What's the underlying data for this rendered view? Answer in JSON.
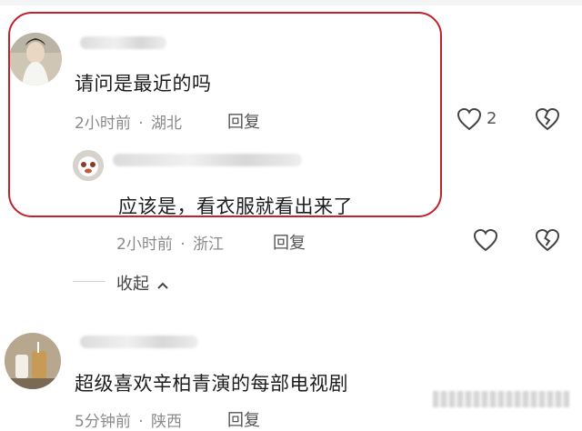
{
  "comments": [
    {
      "text": "请问是最近的吗",
      "time": "2小时前",
      "location": "湖北",
      "reply_label": "回复",
      "likes": "2",
      "like_icon": "heart-outline-icon",
      "dislike_icon": "broken-heart-icon",
      "replies": [
        {
          "text": "应该是，看衣服就看出来了",
          "time": "2小时前",
          "location": "浙江",
          "reply_label": "回复"
        }
      ],
      "collapse_label": "收起"
    },
    {
      "text": "超级喜欢辛柏青演的每部电视剧",
      "time": "5分钟前",
      "location": "陕西",
      "reply_label": "回复"
    }
  ],
  "separator": "·",
  "colors": {
    "highlight_border": "#c0212b",
    "meta_text": "#8a8a8a",
    "body_text": "#1c1c1c"
  }
}
